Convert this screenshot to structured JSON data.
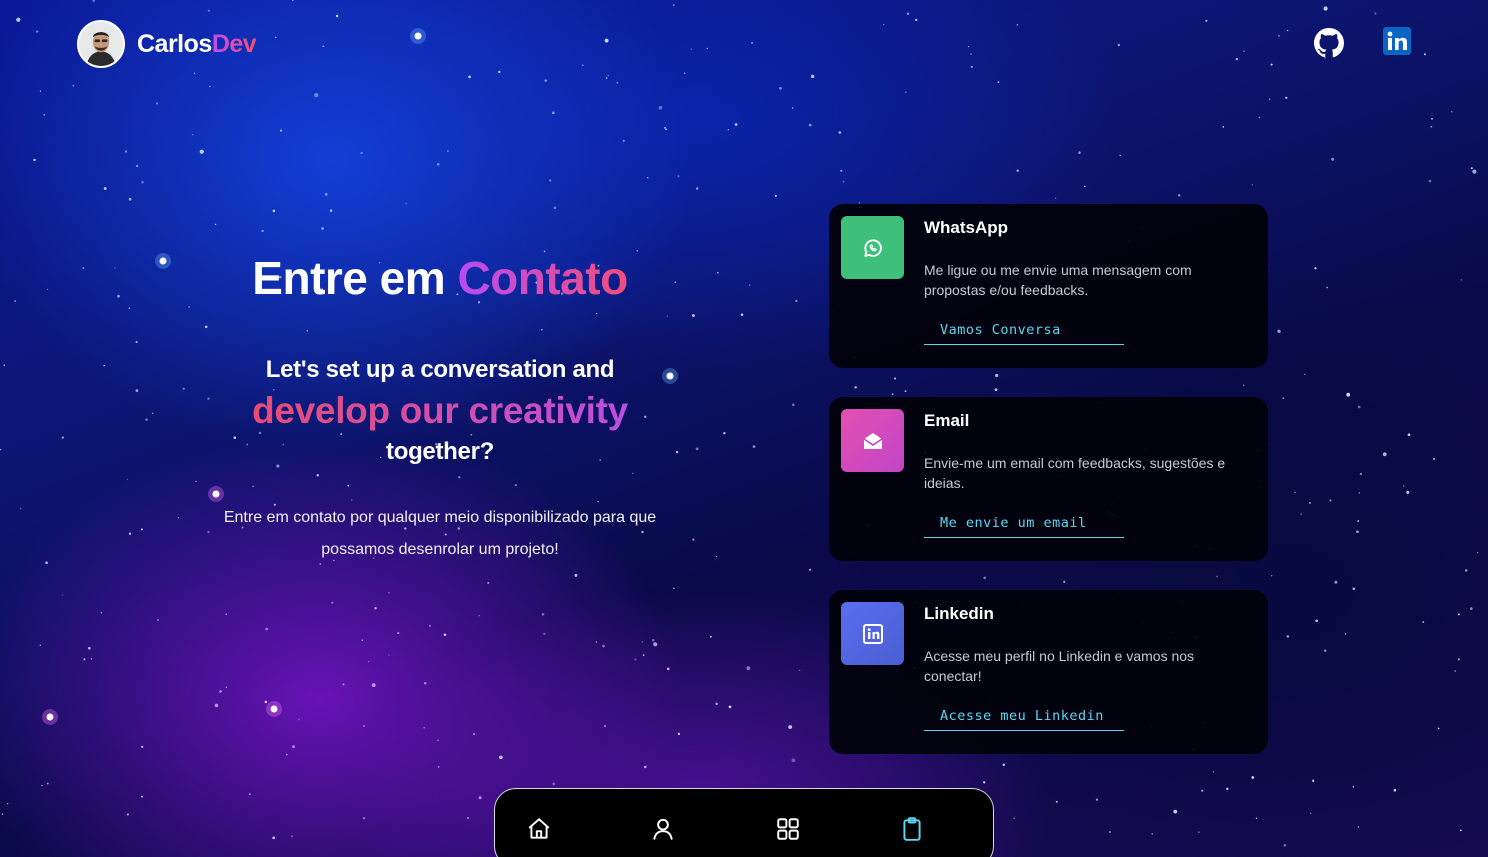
{
  "brand": {
    "name_part1": "Carlos",
    "name_part2": "Dev",
    "avatar": "avatar-photo"
  },
  "header": {
    "social": [
      "github-icon",
      "linkedin-icon"
    ]
  },
  "hero": {
    "title_part1": "Entre em",
    "title_part2": "Contato",
    "subtitle_line1": "Let's set up a conversation and",
    "subtitle_line2": "develop our creativity",
    "subtitle_line3": "together?",
    "description": "Entre em contato por qualquer meio disponibilizado para que possamos desenrolar um projeto!"
  },
  "contacts": [
    {
      "title": "WhatsApp",
      "description": "Me ligue ou me envie uma mensagem com propostas e/ou feedbacks.",
      "link": "Vamos Conversa",
      "icon": "whatsapp-icon",
      "color": "#3fc07a"
    },
    {
      "title": "Email",
      "description": "Envie-me um email com feedbacks, sugestões e ideias.",
      "link": "Me envie um email",
      "icon": "envelope-open-icon",
      "color": "#d84ab0"
    },
    {
      "title": "Linkedin",
      "description": "Acesse meu perfil no Linkedin e vamos nos conectar!",
      "link": "Acesse meu Linkedin",
      "icon": "linkedin-icon",
      "color": "#5168e0"
    }
  ],
  "bottom_nav": {
    "items": [
      "home-icon",
      "user-icon",
      "grid-icon",
      "clipboard-icon"
    ],
    "active": "clipboard-icon"
  },
  "colors": {
    "accent_cyan": "#5ad8f0",
    "gradient_purple": "#b74cf4",
    "gradient_pink": "#f04e7a"
  }
}
